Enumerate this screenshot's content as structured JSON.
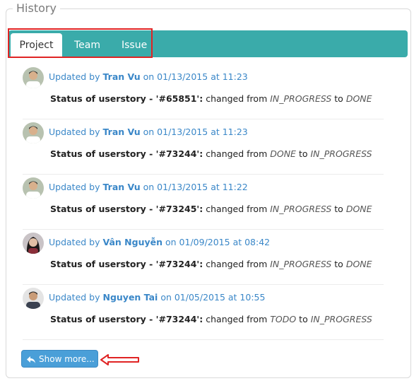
{
  "panel": {
    "title": "History"
  },
  "tabs": [
    {
      "label": "Project",
      "active": true
    },
    {
      "label": "Team",
      "active": false
    },
    {
      "label": "Issue",
      "active": false
    }
  ],
  "entries": [
    {
      "prefix": "Updated by",
      "user": "Tran Vu",
      "on": "on 01/13/2015 at 11:23",
      "status_label": "Status of userstory - '#65851':",
      "changed": "changed from",
      "from": "IN_PROGRESS",
      "to_word": "to",
      "to": "DONE",
      "avatar": "male-avatar"
    },
    {
      "prefix": "Updated by",
      "user": "Tran Vu",
      "on": "on 01/13/2015 at 11:23",
      "status_label": "Status of userstory - '#73244':",
      "changed": "changed from",
      "from": "DONE",
      "to_word": "to",
      "to": "IN_PROGRESS",
      "avatar": "male-avatar"
    },
    {
      "prefix": "Updated by",
      "user": "Tran Vu",
      "on": "on 01/13/2015 at 11:22",
      "status_label": "Status of userstory - '#73245':",
      "changed": "changed from",
      "from": "IN_PROGRESS",
      "to_word": "to",
      "to": "DONE",
      "avatar": "male-avatar"
    },
    {
      "prefix": "Updated by",
      "user": "Vân Nguyễn",
      "on": "on 01/09/2015 at 08:42",
      "status_label": "Status of userstory - '#73244':",
      "changed": "changed from",
      "from": "IN_PROGRESS",
      "to_word": "to",
      "to": "DONE",
      "avatar": "female-avatar"
    },
    {
      "prefix": "Updated by",
      "user": "Nguyen Tai",
      "on": "on 01/05/2015 at 10:55",
      "status_label": "Status of userstory - '#73244':",
      "changed": "changed from",
      "from": "TODO",
      "to_word": "to",
      "to": "IN_PROGRESS",
      "avatar": "male-avatar"
    }
  ],
  "show_more": {
    "label": "Show more...",
    "icon": "reply-icon"
  },
  "colors": {
    "tab_bar": "#3aabaa",
    "link": "#3a87c8",
    "button": "#4a9fd8",
    "highlight": "#e02424"
  }
}
